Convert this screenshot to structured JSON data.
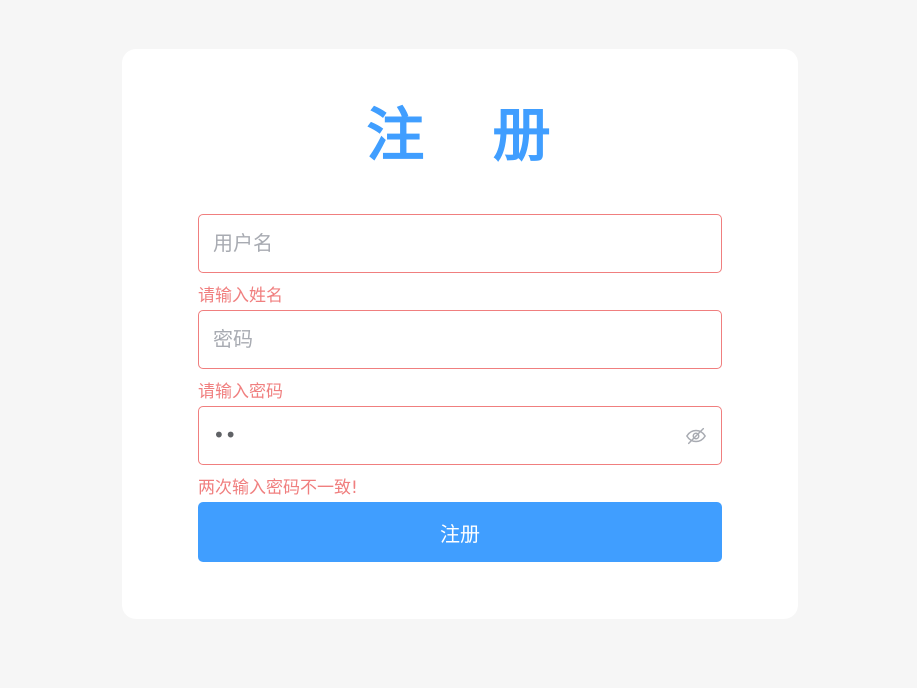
{
  "register": {
    "title": "注 册",
    "username": {
      "placeholder": "用户名",
      "value": "",
      "error": "请输入姓名"
    },
    "password": {
      "placeholder": "密码",
      "value": "",
      "error": "请输入密码"
    },
    "confirm_password": {
      "value": "••",
      "error": "两次输入密码不一致!",
      "toggle_icon": "eye-off-icon"
    },
    "submit_label": "注册"
  },
  "colors": {
    "accent": "#409eff",
    "error": "#f07f7f",
    "background": "#f6f6f6",
    "card": "#ffffff"
  }
}
